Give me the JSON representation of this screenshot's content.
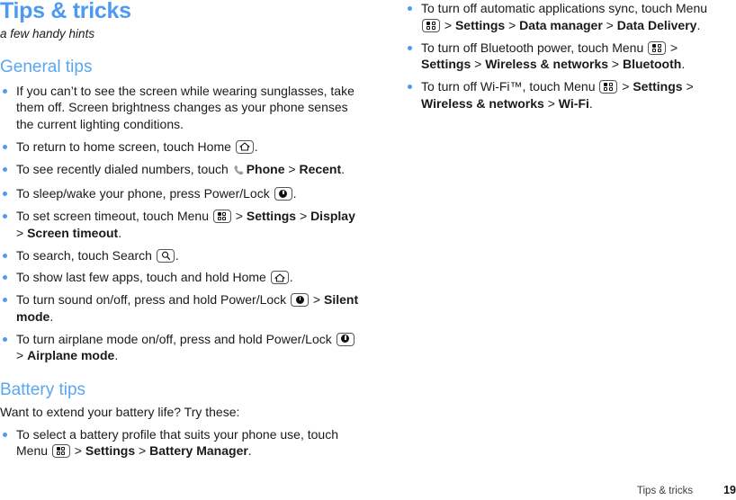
{
  "document": {
    "title": "Tips & tricks",
    "subtitle": "a few handy hints"
  },
  "colors": {
    "heading_blue": "#5aa7f0",
    "title_blue": "#4e9af1",
    "bullet_blue": "#4e9af1",
    "body_text": "#1a1a1a",
    "phone_icon_grey": "#9a9a96"
  },
  "sections": {
    "general_tips": {
      "heading": "General tips",
      "bullets": {
        "b1": {
          "t1": "If you can’t to see the screen while wearing sunglasses, take them off. Screen brightness changes as your phone senses the current lighting conditions."
        },
        "b2": {
          "t1": "To return to home screen, touch Home ",
          "icon": "home-icon",
          "t2": "."
        },
        "b3": {
          "t1": "To see recently dialed numbers, touch ",
          "icon": "phone-icon",
          "t2": "Phone",
          "t3": " > ",
          "t4": "Recent",
          "t5": "."
        },
        "b4": {
          "t1": "To sleep/wake your phone, press Power/Lock ",
          "icon": "power-lock-icon",
          "t2": "."
        },
        "b5": {
          "t1": "To set screen timeout, touch Menu ",
          "icon": "menu-icon",
          "t2": " > ",
          "t3": "Settings",
          "t4": " > ",
          "t5": "Display",
          "t6": " > ",
          "t7": "Screen timeout",
          "t8": "."
        },
        "b6": {
          "t1": "To search, touch Search ",
          "icon": "search-icon",
          "t2": "."
        },
        "b7": {
          "t1": "To show last few apps, touch and hold Home ",
          "icon": "home-icon",
          "t2": "."
        },
        "b8": {
          "t1": "To turn sound on/off, press and hold Power/Lock ",
          "icon": "power-lock-icon",
          "t2": " > ",
          "t3": "Silent mode",
          "t4": "."
        },
        "b9": {
          "t1": "To turn airplane mode on/off, press and hold Power/Lock ",
          "icon": "power-lock-icon",
          "t2": " > ",
          "t3": "Airplane mode",
          "t4": "."
        }
      }
    },
    "battery_tips": {
      "heading": "Battery tips",
      "intro": "Want to extend your battery life? Try these:",
      "bullets": {
        "b1": {
          "t1": "To select a battery profile that suits your phone use, touch Menu ",
          "icon": "menu-icon",
          "t2": " > ",
          "t3": "Settings",
          "t4": " > ",
          "t5": "Battery Manager",
          "t6": "."
        },
        "b2": {
          "t1": "To turn off automatic applications sync, touch Menu ",
          "icon": "menu-icon",
          "t2": " > ",
          "t3": "Settings",
          "t4": " > ",
          "t5": "Data manager",
          "t6": " > ",
          "t7": "Data Delivery",
          "t8": "."
        },
        "b3": {
          "t1": "To turn off Bluetooth power, touch Menu ",
          "icon": "menu-icon",
          "t2": " > ",
          "t3": "Settings",
          "t4": " > ",
          "t5": "Wireless & networks",
          "t6": " > ",
          "t7": "Bluetooth",
          "t8": "."
        },
        "b4": {
          "t1": "To turn off Wi-Fi™, touch Menu ",
          "icon": "menu-icon",
          "t2": " > ",
          "t3": "Settings",
          "t4": " > ",
          "t5": "Wireless & networks",
          "t6": " > ",
          "t7": "Wi-Fi",
          "t8": "."
        }
      }
    }
  },
  "footer": {
    "section_name": "Tips & tricks",
    "page_number": "19"
  }
}
